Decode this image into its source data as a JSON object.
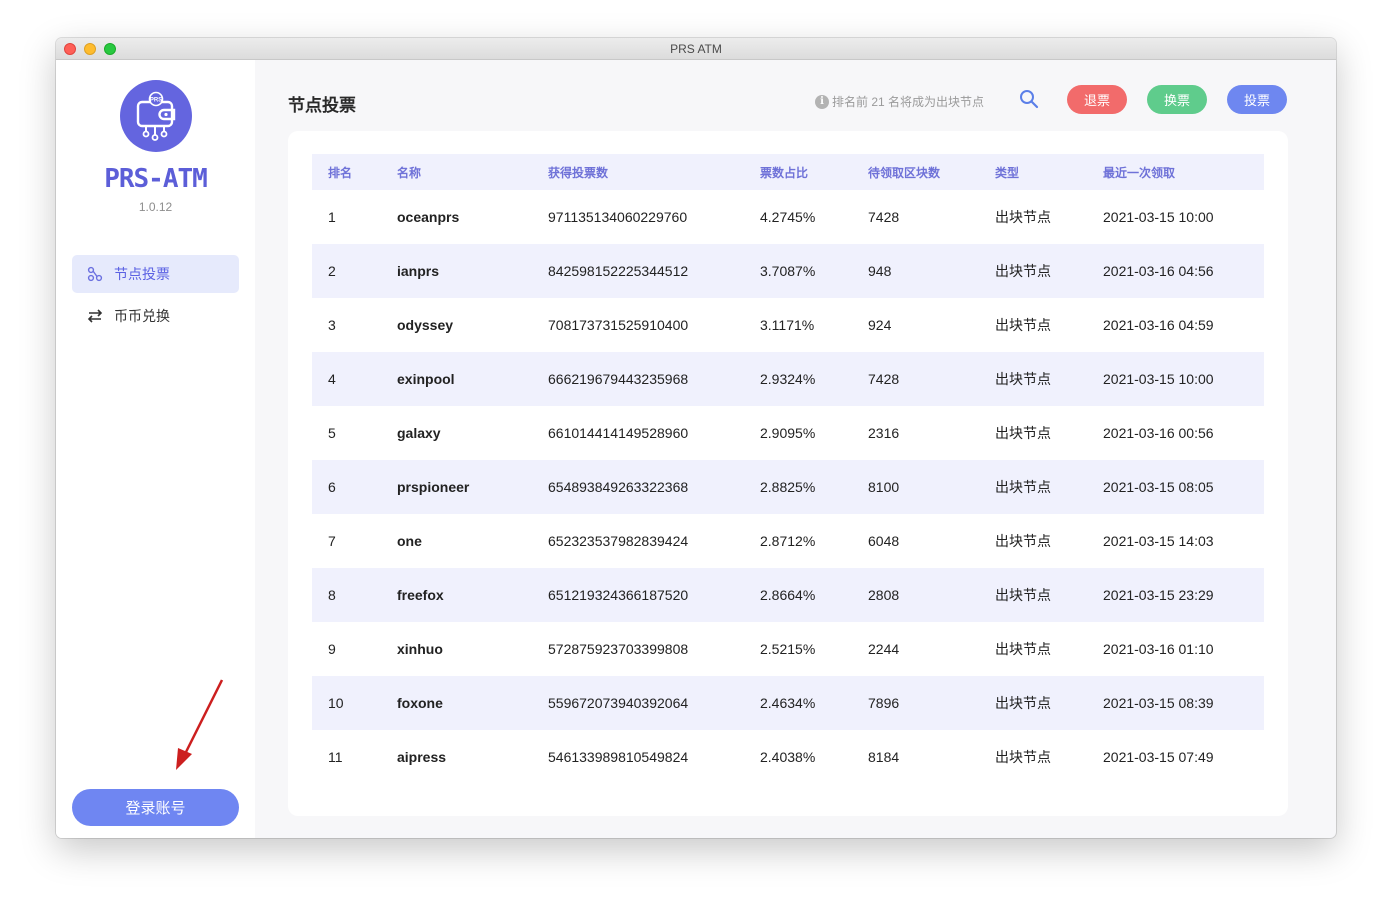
{
  "window": {
    "title": "PRS ATM"
  },
  "sidebar": {
    "brand": "PRS-ATM",
    "version": "1.0.12",
    "logo_badge": "PRS",
    "nav": [
      {
        "label": "节点投票",
        "icon": "nodes-icon",
        "active": true
      },
      {
        "label": "币币兑换",
        "icon": "swap-arrows-icon",
        "active": false
      }
    ],
    "login_label": "登录账号"
  },
  "header": {
    "title": "节点投票",
    "hint": "排名前 21 名将成为出块节点",
    "buttons": {
      "unvote": "退票",
      "swap": "换票",
      "vote": "投票"
    }
  },
  "colors": {
    "accent": "#6465df",
    "unvote": "#f26b6b",
    "swap": "#5fcc8c",
    "vote": "#6e87f0",
    "login": "#6f86f2",
    "row_alt": "#f0f1fd",
    "arrow": "#cc1f1f"
  },
  "table": {
    "columns": [
      "排名",
      "名称",
      "获得投票数",
      "票数占比",
      "待领取区块数",
      "类型",
      "最近一次领取"
    ],
    "rows": [
      [
        "1",
        "oceanprs",
        "971135134060229760",
        "4.2745%",
        "7428",
        "出块节点",
        "2021-03-15 10:00"
      ],
      [
        "2",
        "ianprs",
        "842598152225344512",
        "3.7087%",
        "948",
        "出块节点",
        "2021-03-16 04:56"
      ],
      [
        "3",
        "odyssey",
        "708173731525910400",
        "3.1171%",
        "924",
        "出块节点",
        "2021-03-16 04:59"
      ],
      [
        "4",
        "exinpool",
        "666219679443235968",
        "2.9324%",
        "7428",
        "出块节点",
        "2021-03-15 10:00"
      ],
      [
        "5",
        "galaxy",
        "661014414149528960",
        "2.9095%",
        "2316",
        "出块节点",
        "2021-03-16 00:56"
      ],
      [
        "6",
        "prspioneer",
        "654893849263322368",
        "2.8825%",
        "8100",
        "出块节点",
        "2021-03-15 08:05"
      ],
      [
        "7",
        "one",
        "652323537982839424",
        "2.8712%",
        "6048",
        "出块节点",
        "2021-03-15 14:03"
      ],
      [
        "8",
        "freefox",
        "651219324366187520",
        "2.8664%",
        "2808",
        "出块节点",
        "2021-03-15 23:29"
      ],
      [
        "9",
        "xinhuo",
        "572875923703399808",
        "2.5215%",
        "2244",
        "出块节点",
        "2021-03-16 01:10"
      ],
      [
        "10",
        "foxone",
        "559672073940392064",
        "2.4634%",
        "7896",
        "出块节点",
        "2021-03-15 08:39"
      ],
      [
        "11",
        "aipress",
        "546133989810549824",
        "2.4038%",
        "8184",
        "出块节点",
        "2021-03-15 07:49"
      ]
    ]
  }
}
